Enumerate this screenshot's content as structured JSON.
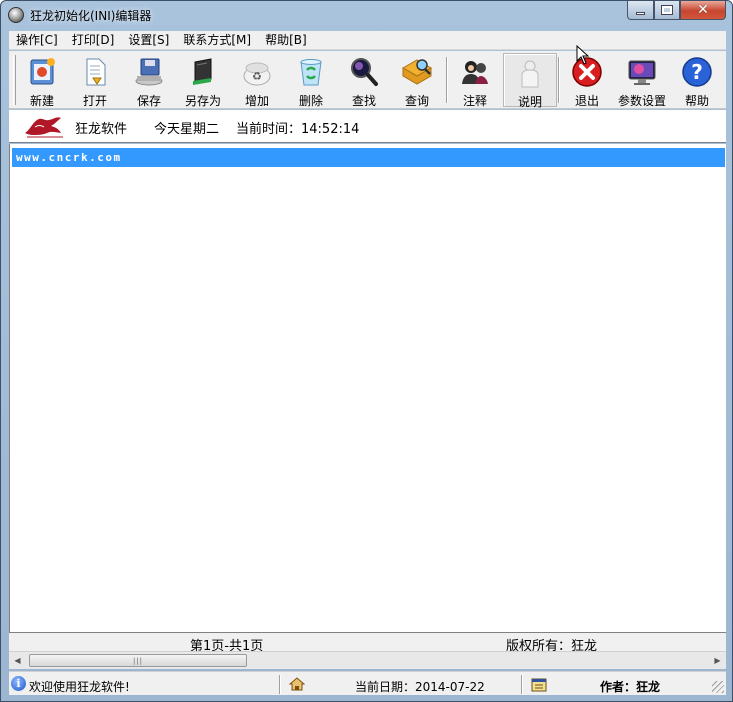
{
  "window": {
    "title": "狂龙初始化(INI)编辑器"
  },
  "menu": [
    {
      "label": "操作[C]"
    },
    {
      "label": "打印[D]"
    },
    {
      "label": "设置[S]"
    },
    {
      "label": "联系方式[M]"
    },
    {
      "label": "帮助[B]"
    }
  ],
  "toolbar": [
    {
      "label": "新建",
      "icon": "new-document-icon"
    },
    {
      "label": "打开",
      "icon": "open-document-icon"
    },
    {
      "label": "保存",
      "icon": "floppy-disk-icon"
    },
    {
      "label": "另存为",
      "icon": "save-as-icon"
    },
    {
      "label": "增加",
      "icon": "recycle-icon"
    },
    {
      "label": "删除",
      "icon": "recycle-bin-icon"
    },
    {
      "label": "查找",
      "icon": "magnifier-icon"
    },
    {
      "label": "查询",
      "icon": "folder-search-icon"
    },
    {
      "label": "注释",
      "icon": "users-icon"
    },
    {
      "label": "说明",
      "icon": "person-icon"
    },
    {
      "label": "退出",
      "icon": "exit-icon"
    },
    {
      "label": "参数设置",
      "icon": "monitor-icon"
    },
    {
      "label": "帮助",
      "icon": "help-icon"
    }
  ],
  "infobar": {
    "company": "狂龙软件",
    "weekday": "今天星期二",
    "time": "当前时间：14:52:14"
  },
  "content": {
    "rows": [
      "www.cncrk.com"
    ]
  },
  "pagebar": {
    "page": "第1页-共1页",
    "copyright": "版权所有：狂龙"
  },
  "statusbar": {
    "welcome": "欢迎使用狂龙软件!",
    "date": "当前日期：2014-07-22",
    "author": "作者：狂龙"
  },
  "colors": {
    "selection": "#3399ff",
    "chrome": "#f0f0f0",
    "frame": "#a9c3dd",
    "close_button": "#c7452f"
  }
}
